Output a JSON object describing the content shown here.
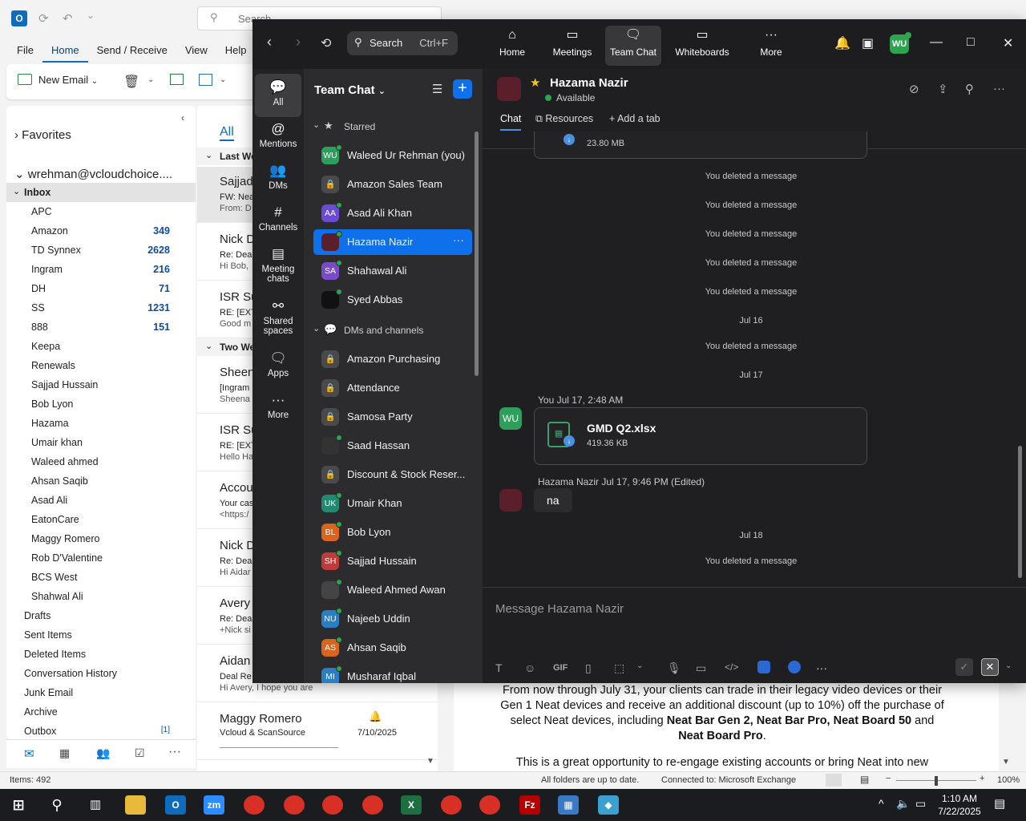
{
  "outlook": {
    "search_placeholder": "Search",
    "menu": [
      "File",
      "Home",
      "Send / Receive",
      "View",
      "Help"
    ],
    "new_email": "New Email",
    "favorites": "Favorites",
    "account": "wrehman@vcloudchoice....",
    "folders": [
      {
        "name": "Inbox",
        "count": ""
      },
      {
        "name": "APC",
        "count": ""
      },
      {
        "name": "Amazon",
        "count": "349"
      },
      {
        "name": "TD Synnex",
        "count": "2628"
      },
      {
        "name": "Ingram",
        "count": "216"
      },
      {
        "name": "DH",
        "count": "71"
      },
      {
        "name": "SS",
        "count": "1231"
      },
      {
        "name": "888",
        "count": "151"
      },
      {
        "name": "Keepa",
        "count": ""
      },
      {
        "name": "Renewals",
        "count": ""
      },
      {
        "name": "Sajjad Hussain",
        "count": ""
      },
      {
        "name": "Bob Lyon",
        "count": ""
      },
      {
        "name": "Hazama",
        "count": ""
      },
      {
        "name": "Umair khan",
        "count": ""
      },
      {
        "name": "Waleed ahmed",
        "count": ""
      },
      {
        "name": "Ahsan Saqib",
        "count": ""
      },
      {
        "name": "Asad Ali",
        "count": ""
      },
      {
        "name": "EatonCare",
        "count": ""
      },
      {
        "name": "Maggy Romero",
        "count": ""
      },
      {
        "name": "Rob D'Valentine",
        "count": ""
      },
      {
        "name": "BCS West",
        "count": ""
      },
      {
        "name": "Shahwal Ali",
        "count": ""
      },
      {
        "name": "Drafts",
        "count": ""
      },
      {
        "name": "Sent Items",
        "count": ""
      },
      {
        "name": "Deleted Items",
        "count": ""
      },
      {
        "name": "Conversation History",
        "count": ""
      },
      {
        "name": "Junk Email",
        "count": ""
      },
      {
        "name": "Archive",
        "count": ""
      },
      {
        "name": "Outbox",
        "count": "[1]"
      }
    ],
    "list_filter": "All",
    "group_last_week": "Last We",
    "group_two_weeks": "Two We",
    "mails": [
      {
        "from": "Sajjad",
        "subj": "FW: Nea",
        "prev": "From: D"
      },
      {
        "from": "Nick D",
        "subj": "Re: Dea",
        "prev": "Hi Bob,"
      },
      {
        "from": "ISR Su",
        "subj": "RE: [EXT",
        "prev": "Good m"
      },
      {
        "from": "Sheen",
        "subj": "[Ingram",
        "prev": "Sheena"
      },
      {
        "from": "ISR Su",
        "subj": "RE: [EXT",
        "prev": "Hello Ha"
      },
      {
        "from": "Accou",
        "subj": "Your cas",
        "prev": "<https:/"
      },
      {
        "from": "Nick D",
        "subj": "Re: Dea",
        "prev": "Hi Aidar"
      },
      {
        "from": "Avery",
        "subj": "Re: Dea",
        "prev": "+Nick si"
      },
      {
        "from": "Aidan",
        "subj": "Deal Re",
        "prev": "Hi Avery,  I hope you are"
      },
      {
        "from": "Maggy Romero",
        "subj": "Vcloud & ScanSource",
        "prev": "",
        "date": "7/10/2025"
      }
    ],
    "reading_p1_a": "From now through July 31, your clients can trade in their legacy video devices or their Gen 1 Neat devices and receive an additional discount (up to 10%) off the purchase of select Neat devices, including ",
    "reading_p1_b": "Neat Bar Gen 2, Neat Bar Pro, Neat Board 50",
    "reading_p1_c": " and ",
    "reading_p1_d": "Neat Board Pro",
    "reading_p1_e": ".",
    "reading_p2": "This is a great opportunity to re-engage existing accounts or bring Neat into new",
    "status_items": "Items: 492",
    "status_sync": "All folders are up to date.",
    "status_conn": "Connected to: Microsoft Exchange",
    "status_zoom": "100%"
  },
  "zoom": {
    "search_label": "Search",
    "search_kbd": "Ctrl+F",
    "tabs": [
      "Home",
      "Meetings",
      "Team Chat",
      "Whiteboards",
      "More"
    ],
    "avatar": "WU",
    "rail": [
      "All",
      "Mentions",
      "DMs",
      "Channels",
      "Meeting chats",
      "Shared spaces",
      "Apps",
      "More"
    ],
    "list_title": "Team Chat",
    "section_starred": "Starred",
    "section_dms": "DMs and channels",
    "starred": [
      {
        "name": "Waleed Ur Rehman (you)",
        "initials": "WU",
        "color": "#2e9e5b"
      },
      {
        "name": "Amazon Sales Team",
        "initials": "",
        "color": "#4a4a4c"
      },
      {
        "name": "Asad Ali Khan",
        "initials": "AA",
        "color": "#6b4bd6"
      },
      {
        "name": "Hazama Nazir",
        "initials": "",
        "color": "#5a1f2a"
      },
      {
        "name": "Shahawal Ali",
        "initials": "SA",
        "color": "#7a4bc9"
      },
      {
        "name": "Syed Abbas",
        "initials": "",
        "color": "#111111"
      }
    ],
    "dms": [
      {
        "name": "Amazon Purchasing",
        "initials": "",
        "color": "#4a4a4c"
      },
      {
        "name": "Attendance",
        "initials": "",
        "color": "#4a4a4c"
      },
      {
        "name": "Samosa Party",
        "initials": "",
        "color": "#4a4a4c"
      },
      {
        "name": "Saad Hassan",
        "initials": "",
        "color": "#333333"
      },
      {
        "name": "Discount & Stock Reser...",
        "initials": "",
        "color": "#4a4a4c"
      },
      {
        "name": "Umair Khan",
        "initials": "UK",
        "color": "#1f8a70"
      },
      {
        "name": "Bob Lyon",
        "initials": "BL",
        "color": "#d9641e"
      },
      {
        "name": "Sajjad Hussain",
        "initials": "SH",
        "color": "#c23b3b"
      },
      {
        "name": "Waleed Ahmed Awan",
        "initials": "",
        "color": "#444444"
      },
      {
        "name": "Najeeb Uddin",
        "initials": "NU",
        "color": "#2a7fc4"
      },
      {
        "name": "Ahsan Saqib",
        "initials": "AS",
        "color": "#d9641e"
      },
      {
        "name": "Musharaf Iqbal",
        "initials": "MI",
        "color": "#2a7fc4"
      }
    ],
    "chat": {
      "name": "Hazama Nazir",
      "status": "Available",
      "tab_chat": "Chat",
      "tab_resources": "Resources",
      "tab_add": "+ Add a tab",
      "top_file_size": "23.80 MB",
      "deleted": "You deleted a message",
      "date_16": "Jul 16",
      "date_17": "Jul 17",
      "date_18": "Jul 18",
      "my_meta": "You Jul 17, 2:48 AM",
      "my_avatar": "WU",
      "file_name": "GMD Q2.xlsx",
      "file_size": "419.36 KB",
      "their_meta": "Hazama Nazir Jul 17, 9:46 PM (Edited)",
      "their_msg": "na",
      "compose_placeholder": "Message Hazama Nazir",
      "gif": "GIF"
    }
  },
  "taskbar": {
    "time": "1:10 AM",
    "date": "7/22/2025"
  }
}
